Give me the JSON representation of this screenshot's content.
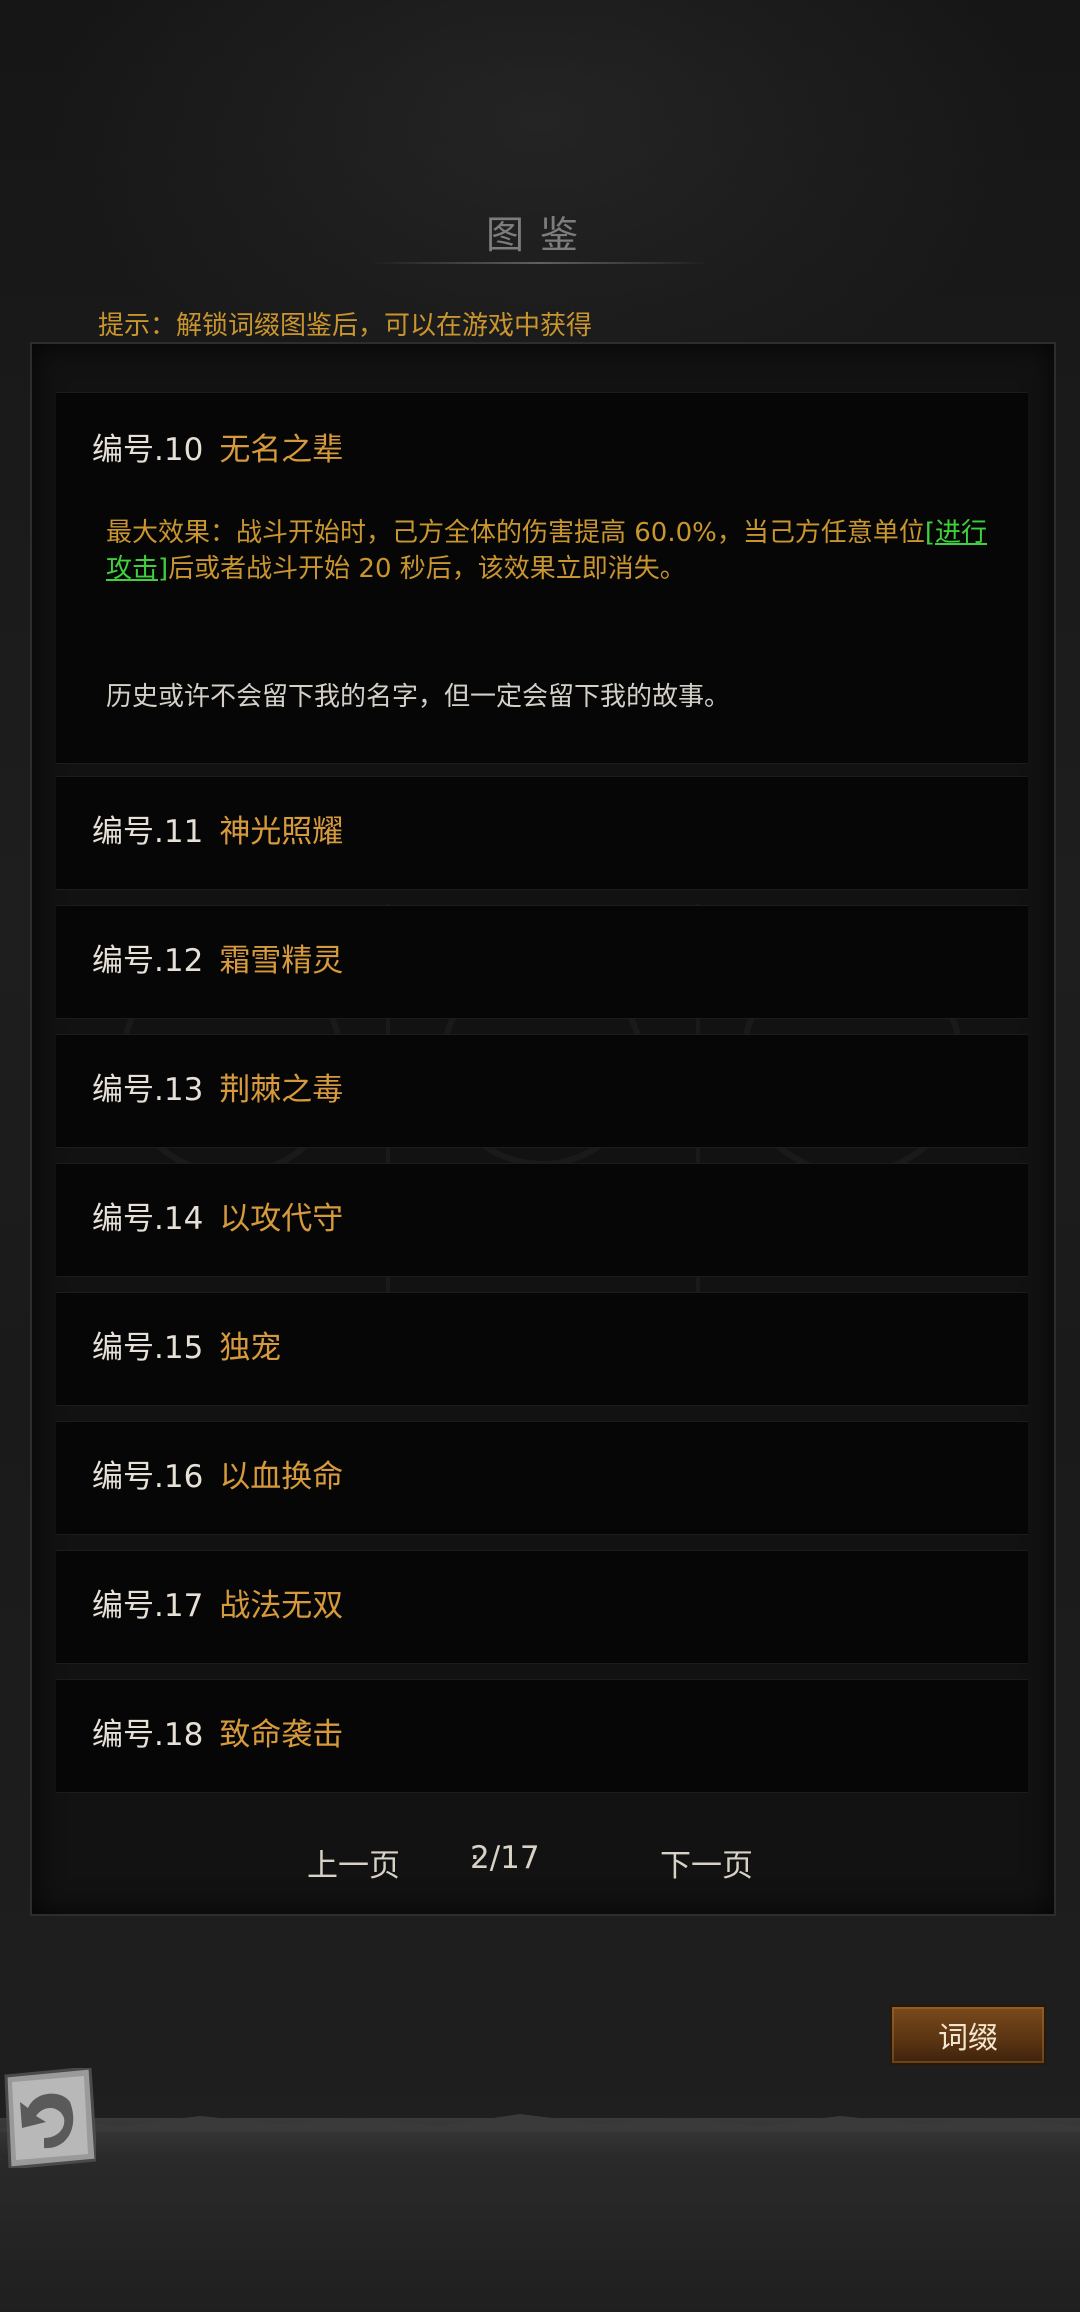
{
  "header": {
    "title": "图鉴",
    "hint": "提示：解锁词缀图鉴后，可以在游戏中获得"
  },
  "entries": [
    {
      "number": "编号.10",
      "name": "无名之辈",
      "effect_before": "最大效果：战斗开始时，己方全体的伤害提高 60.0%，当己方任意单位",
      "effect_link": "[进行攻击]",
      "effect_after": "后或者战斗开始 20 秒后，该效果立即消失。",
      "story": "历史或许不会留下我的名字，但一定会留下我的故事。"
    },
    {
      "number": "编号.11",
      "name": "神光照耀"
    },
    {
      "number": "编号.12",
      "name": "霜雪精灵"
    },
    {
      "number": "编号.13",
      "name": "荆棘之毒"
    },
    {
      "number": "编号.14",
      "name": "以攻代守"
    },
    {
      "number": "编号.15",
      "name": "独宠"
    },
    {
      "number": "编号.16",
      "name": "以血换命"
    },
    {
      "number": "编号.17",
      "name": "战法无双"
    },
    {
      "number": "编号.18",
      "name": "致命袭击"
    }
  ],
  "pager": {
    "prev_label": "上一页",
    "page_indicator": "2/17",
    "next_label": "下一页"
  },
  "buttons": {
    "tag_label": "词缀"
  },
  "icons": {
    "back": "back-arrow-icon"
  },
  "colors": {
    "accent_gold": "#d69a3c",
    "hint_text": "#c9952f",
    "link_green": "#3fcf3f"
  }
}
